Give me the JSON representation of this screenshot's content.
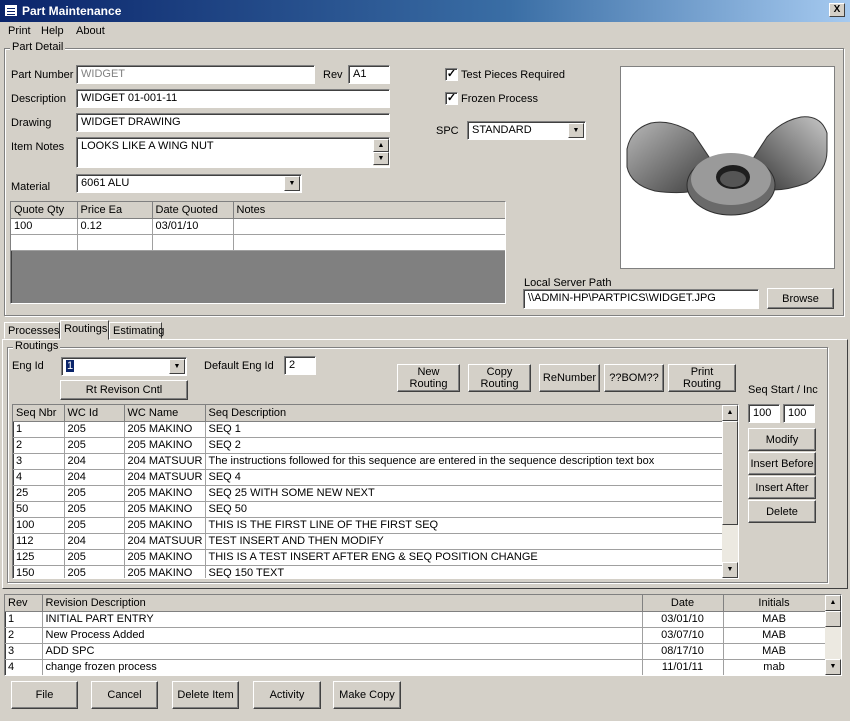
{
  "window": {
    "title": "Part Maintenance",
    "close": "X"
  },
  "menu": [
    "Print",
    "Help",
    "About"
  ],
  "part_detail": {
    "legend": "Part Detail",
    "part_number_label": "Part Number",
    "part_number": "WIDGET",
    "rev_label": "Rev",
    "rev": "A1",
    "description_label": "Description",
    "description": "WIDGET 01-001-11",
    "drawing_label": "Drawing",
    "drawing": "WIDGET DRAWING",
    "item_notes_label": "Item Notes",
    "item_notes": "LOOKS LIKE A WING NUT",
    "material_label": "Material",
    "material": "6061 ALU",
    "test_pieces_label": "Test Pieces Required",
    "test_pieces_checked": true,
    "frozen_label": "Frozen Process",
    "frozen_checked": true,
    "spc_label": "SPC",
    "spc": "STANDARD",
    "local_path_label": "Local Server Path",
    "local_path": "\\\\ADMIN-HP\\PARTPICS\\WIDGET.JPG",
    "browse": "Browse",
    "image_subject": "wing-nut",
    "quote_headers": [
      "Quote Qty",
      "Price Ea",
      "Date Quoted",
      "Notes"
    ],
    "quote_rows": [
      [
        "100",
        "0.12",
        "03/01/10",
        ""
      ],
      [
        "",
        "",
        "",
        ""
      ]
    ]
  },
  "tabs": [
    "Processes",
    "Routings",
    "Estimating"
  ],
  "active_tab": "Routings",
  "routings": {
    "legend": "Routings",
    "eng_id_label": "Eng Id",
    "eng_id": "1",
    "default_eng_label": "Default Eng Id",
    "default_eng": "2",
    "rt_revision": "Rt Revison Cntl",
    "new_routing": [
      "New",
      "Routing"
    ],
    "copy_routing": [
      "Copy",
      "Routing"
    ],
    "renumber": "ReNumber",
    "bom": "??BOM??",
    "print_routing": [
      "Print",
      "Routing"
    ],
    "seq_label": "Seq Start / Inc",
    "seq_start": "100",
    "seq_inc": "100",
    "modify": "Modify",
    "insert_before": "Insert Before",
    "insert_after": "Insert After",
    "delete": "Delete",
    "headers": [
      "Seq Nbr",
      "WC Id",
      "WC Name",
      "Seq Description"
    ],
    "rows": [
      [
        "1",
        "205",
        "205 MAKINO",
        "SEQ 1"
      ],
      [
        "2",
        "205",
        "205 MAKINO",
        "SEQ 2"
      ],
      [
        "3",
        "204",
        "204 MATSUUR",
        "The instructions followed for this sequence are entered in the sequence description text box"
      ],
      [
        "4",
        "204",
        "204 MATSUUR",
        "SEQ 4"
      ],
      [
        "25",
        "205",
        "205 MAKINO",
        "SEQ 25 WITH SOME NEW NEXT"
      ],
      [
        "50",
        "205",
        "205 MAKINO",
        "SEQ 50"
      ],
      [
        "100",
        "205",
        "205 MAKINO",
        "THIS IS THE FIRST LINE OF THE FIRST SEQ"
      ],
      [
        "112",
        "204",
        "204 MATSUUR",
        "TEST INSERT AND THEN MODIFY"
      ],
      [
        "125",
        "205",
        "205 MAKINO",
        "THIS IS A TEST INSERT AFTER ENG & SEQ POSITION CHANGE"
      ],
      [
        "150",
        "205",
        "205 MAKINO",
        "SEQ 150 TEXT"
      ]
    ]
  },
  "revisions": {
    "headers": [
      "Rev",
      "Revision Description",
      "Date",
      "Initials"
    ],
    "rows": [
      [
        "1",
        "INITIAL PART ENTRY",
        "03/01/10",
        "MAB"
      ],
      [
        "2",
        "New Process Added",
        "03/07/10",
        "MAB"
      ],
      [
        "3",
        "ADD SPC",
        "08/17/10",
        "MAB"
      ],
      [
        "4",
        "change frozen process",
        "11/01/11",
        "mab"
      ]
    ]
  },
  "footer": {
    "file": "File",
    "cancel": "Cancel",
    "delete_item": "Delete Item",
    "activity": "Activity",
    "make_copy": "Make Copy"
  }
}
